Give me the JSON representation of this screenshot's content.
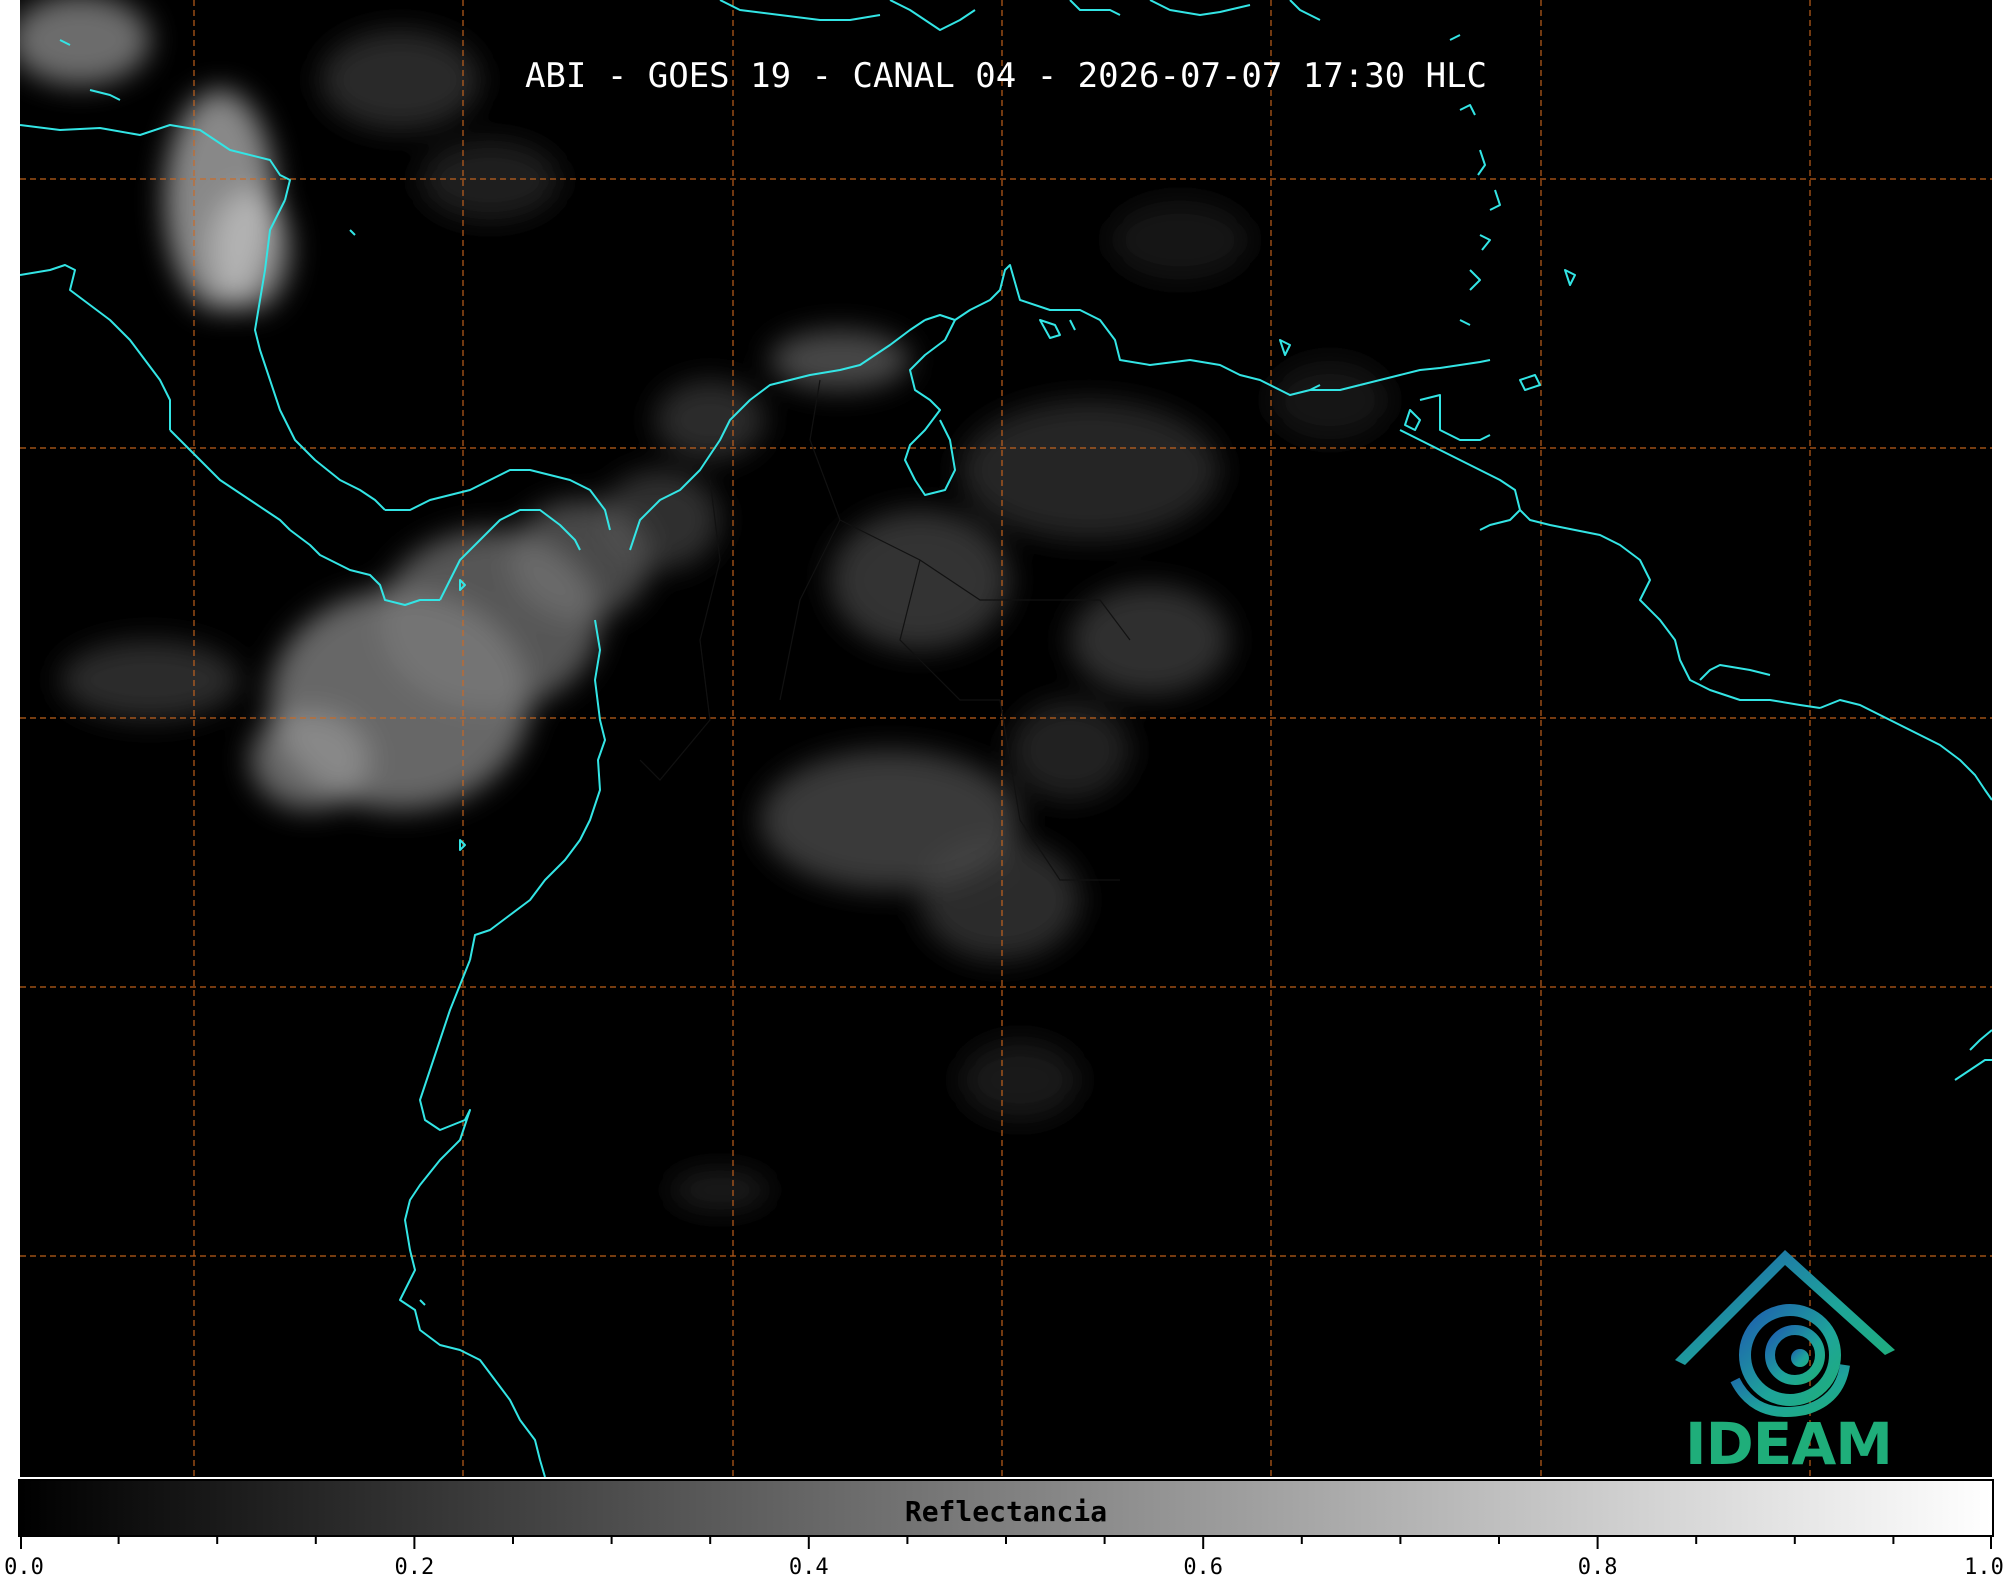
{
  "map": {
    "title": "ABI - GOES 19 - CANAL 04 - 2026-07-07 17:30 HLC",
    "grid_color": "#d2691e",
    "coast_color": "#33e5e5",
    "background_color": "#000000"
  },
  "logo": {
    "text": "IDEAM",
    "icon": "ideam-mountain-swirl-icon",
    "color": "#1fae7a"
  },
  "colorbar": {
    "label": "Reflectancia",
    "min": 0.0,
    "max": 1.0,
    "ticks": [
      "0.0",
      "0.2",
      "0.4",
      "0.6",
      "0.8",
      "1.0"
    ],
    "gradient_from": "#000000",
    "gradient_to": "#ffffff"
  }
}
